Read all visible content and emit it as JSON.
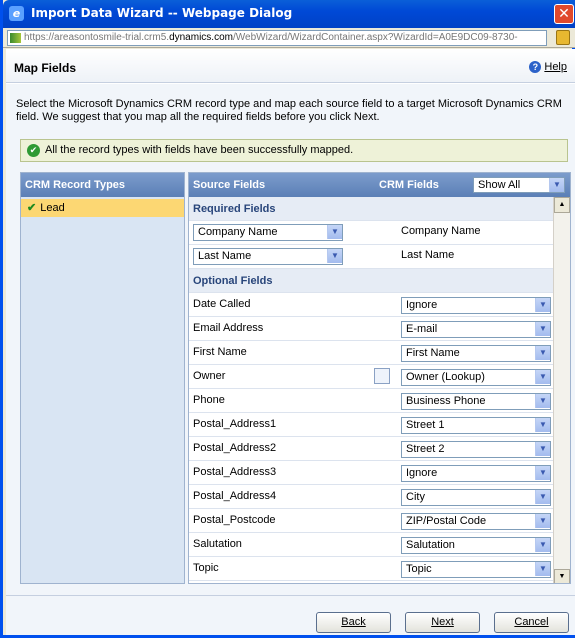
{
  "window": {
    "title": "Import Data Wizard -- Webpage Dialog",
    "close_glyph": "✕"
  },
  "address": {
    "prefix": "https://areasontosmile-trial.crm5.",
    "domain": "dynamics.com",
    "suffix": "/WebWizard/WizardContainer.aspx?WizardId=A0E9DC09-8730-"
  },
  "page": {
    "title": "Map Fields",
    "help_label": "Help",
    "help_icon": "help-icon"
  },
  "instructions": "Select the Microsoft Dynamics CRM record type and map each source field to a target Microsoft Dynamics CRM field. We suggest that you map all the required fields before you click Next.",
  "status_message": "All the record types with fields have been successfully mapped.",
  "record_types": {
    "header": "CRM Record Types",
    "items": [
      {
        "label": "Lead"
      }
    ]
  },
  "mapping": {
    "source_header": "Source Fields",
    "crm_header": "CRM Fields",
    "filter_value": "Show All",
    "required_title": "Required Fields",
    "required": [
      {
        "source": "Company Name",
        "target": "Company Name"
      },
      {
        "source": "Last Name",
        "target": "Last Name"
      }
    ],
    "optional_title": "Optional Fields",
    "optional": [
      {
        "source": "Date Called",
        "target": "Ignore"
      },
      {
        "source": "Email Address",
        "target": "E-mail"
      },
      {
        "source": "First Name",
        "target": "First Name"
      },
      {
        "source": "Owner",
        "target": "Owner (Lookup)"
      },
      {
        "source": "Phone",
        "target": "Business Phone"
      },
      {
        "source": "Postal_Address1",
        "target": "Street 1"
      },
      {
        "source": "Postal_Address2",
        "target": "Street 2"
      },
      {
        "source": "Postal_Address3",
        "target": "Ignore"
      },
      {
        "source": "Postal_Address4",
        "target": "City"
      },
      {
        "source": "Postal_Postcode",
        "target": "ZIP/Postal Code"
      },
      {
        "source": "Salutation",
        "target": "Salutation"
      },
      {
        "source": "Topic",
        "target": "Topic"
      }
    ]
  },
  "buttons": {
    "back": "Back",
    "next": "Next",
    "cancel": "Cancel"
  }
}
